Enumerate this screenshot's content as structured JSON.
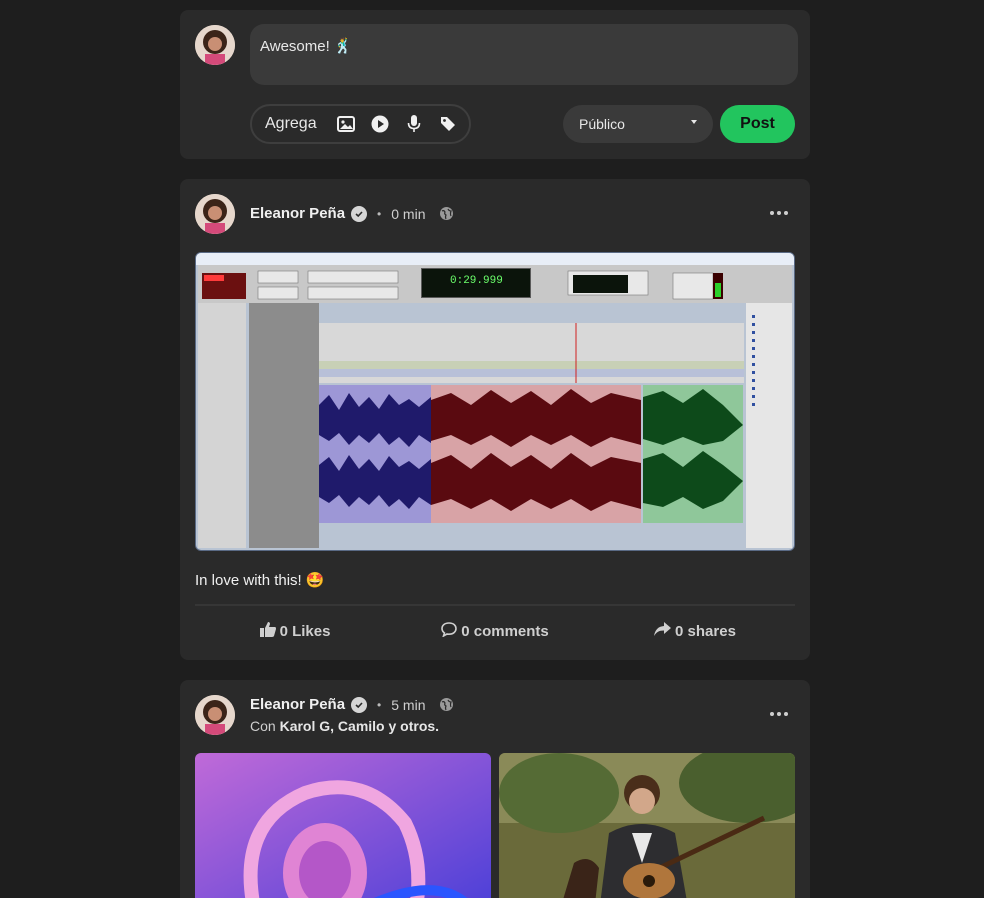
{
  "composer": {
    "text": "Awesome! 🕺",
    "add_label": "Agrega",
    "icons": [
      "image-icon",
      "play-icon",
      "microphone-icon",
      "tag-icon"
    ],
    "privacy": "Público",
    "post_label": "Post"
  },
  "posts": [
    {
      "author": "Eleanor Peña",
      "time": "0 min",
      "text": "In love with this! 🤩",
      "likes": "0 Likes",
      "comments": "0 comments",
      "shares": "0 shares",
      "daw": {
        "counter": "0:29.999"
      }
    },
    {
      "author": "Eleanor Peña",
      "time": "5 min",
      "with_prefix": "Con",
      "with_names": "Karol G, Camilo y otros."
    }
  ],
  "colors": {
    "accent": "#22c55e",
    "card": "#2a2a2a",
    "background": "#1e1e1e",
    "clip_purple": "#9d97d6",
    "clip_red": "#d8a3a6",
    "clip_green": "#8fc79a"
  }
}
